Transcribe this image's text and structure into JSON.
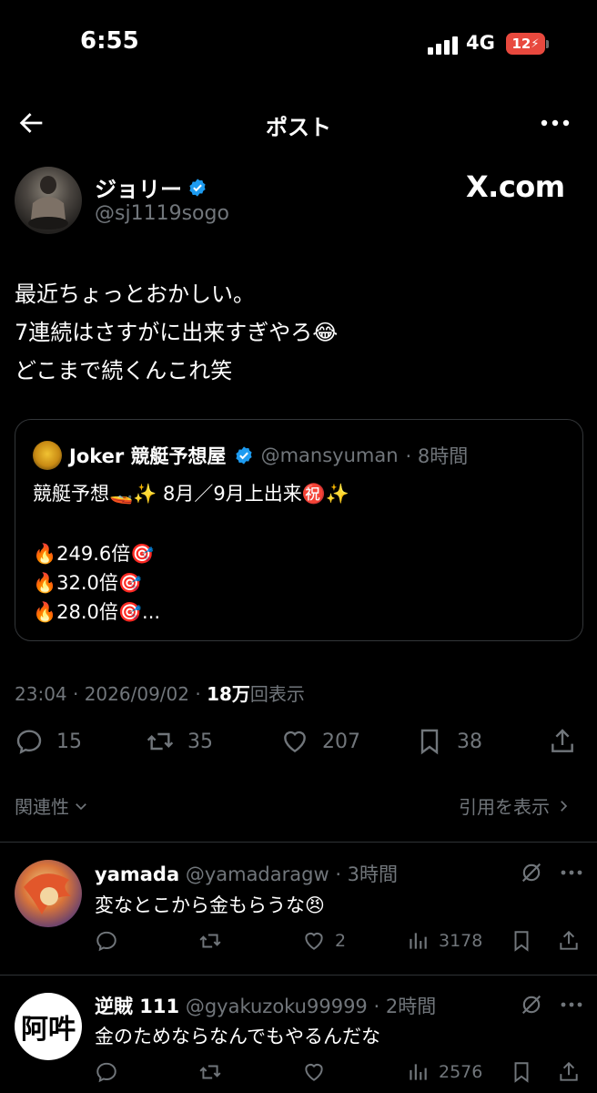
{
  "status_bar": {
    "time": "6:55",
    "network": "4G",
    "battery": "12"
  },
  "header": {
    "title": "ポスト"
  },
  "post": {
    "author_name": "ジョリー",
    "author_handle": "@sj1119sogo",
    "watermark": "X.com",
    "lines": [
      "最近ちょっとおかしい。",
      "7連続はさすがに出来すぎやろ😂",
      "どこまで続くんこれ笑"
    ],
    "quoted": {
      "name": "Joker 競艇予想屋",
      "handle": "@mansyuman",
      "time": "· 8時間",
      "lines": [
        "競艇予想🚤✨ 8月／9月上出来㊗️✨",
        "🔥249.6倍🎯",
        "🔥32.0倍🎯",
        "🔥28.0倍🎯..."
      ]
    },
    "meta_time": "23:04 · 2026/09/02 · ",
    "meta_views": "18万",
    "meta_views_label": "回表示",
    "actions": {
      "replies": "15",
      "reposts": "35",
      "likes": "207",
      "bookmarks": "38"
    }
  },
  "filters": {
    "relevance_label": "関連性",
    "quotes_label": "引用を表示"
  },
  "replies": [
    {
      "name": "yamada",
      "handle": "@yamadaragw",
      "time": "· 3時間",
      "text": "変なとこから金もらうな😠",
      "replies": "",
      "reposts": "",
      "likes": "2",
      "views": "3178"
    },
    {
      "name": "逆賊 111",
      "handle": "@gyakuzoku99999",
      "time": "· 2時間",
      "text": "金のためならなんでもやるんだな",
      "avatar_text": "阿吽",
      "replies": "",
      "reposts": "",
      "likes": "",
      "views": "2576"
    }
  ],
  "colors": {
    "background": "#000000",
    "text": "#e7e9ea",
    "muted": "#71767b",
    "verified": "#1d9bf0",
    "divider": "#2f3336"
  }
}
